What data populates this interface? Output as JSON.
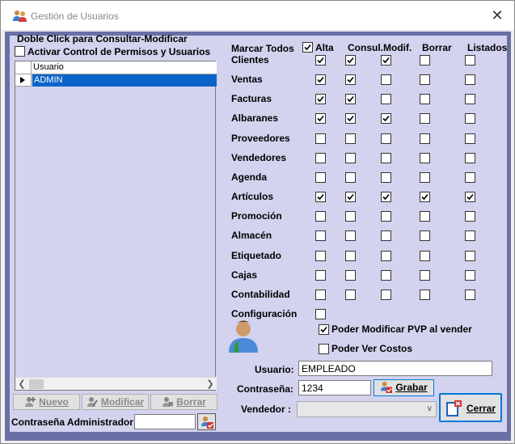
{
  "window": {
    "title": "Gestión de Usuarios",
    "close_glyph": "✕"
  },
  "left": {
    "section_title": "Doble Click para Consultar-Modificar",
    "enable_control_label": "Activar Control de Permisos y Usuarios",
    "enable_control_checked": false,
    "grid": {
      "column_header": "Usuario",
      "rows": [
        "ADMIN"
      ]
    },
    "buttons": {
      "new": "Nuevo",
      "modify": "Modificar",
      "delete": "Borrar"
    },
    "admin_password_label": "Contraseña Administrador:",
    "admin_password_value": ""
  },
  "permissions": {
    "mark_all_label": "Marcar Todos",
    "mark_all_checked": true,
    "columns": [
      "Alta",
      "Consul.",
      "Modif.",
      "Borrar",
      "Listados"
    ],
    "rows": [
      {
        "label": "Clientes",
        "checks": [
          true,
          true,
          true,
          false,
          false
        ]
      },
      {
        "label": "Ventas",
        "checks": [
          true,
          true,
          false,
          false,
          false
        ]
      },
      {
        "label": "Facturas",
        "checks": [
          true,
          true,
          false,
          false,
          false
        ]
      },
      {
        "label": "Albaranes",
        "checks": [
          true,
          true,
          true,
          false,
          false
        ]
      },
      {
        "label": "Proveedores",
        "checks": [
          false,
          false,
          false,
          false,
          false
        ]
      },
      {
        "label": "Vendedores",
        "checks": [
          false,
          false,
          false,
          false,
          false
        ]
      },
      {
        "label": "Agenda",
        "checks": [
          false,
          false,
          false,
          false,
          false
        ]
      },
      {
        "label": "Artículos",
        "checks": [
          true,
          true,
          true,
          true,
          true
        ]
      },
      {
        "label": "Promoción",
        "checks": [
          false,
          false,
          false,
          false,
          false
        ]
      },
      {
        "label": "Almacén",
        "checks": [
          false,
          false,
          false,
          false,
          false
        ]
      },
      {
        "label": "Etiquetado",
        "checks": [
          false,
          false,
          false,
          false,
          false
        ]
      },
      {
        "label": "Cajas",
        "checks": [
          false,
          false,
          false,
          false,
          false
        ]
      },
      {
        "label": "Contabilidad",
        "checks": [
          false,
          false,
          false,
          false,
          false
        ]
      },
      {
        "label": "Configuración",
        "checks": [
          false
        ]
      }
    ],
    "pvp_label": "Poder Modificar PVP al vender",
    "pvp_checked": true,
    "costs_label": "Poder Ver Costos",
    "costs_checked": false
  },
  "form": {
    "user_label": "Usuario:",
    "user_value": "EMPLEADO",
    "password_label": "Contraseña:",
    "password_value": "1234",
    "save_label": "Grabar",
    "seller_label": "Vendedor :",
    "seller_value": "",
    "close_label": "Cerrar"
  },
  "colors": {
    "border": "#6a6fa6",
    "panel": "#d3d3ef",
    "selection": "#0a64c8",
    "button_focus": "#0078d7"
  }
}
